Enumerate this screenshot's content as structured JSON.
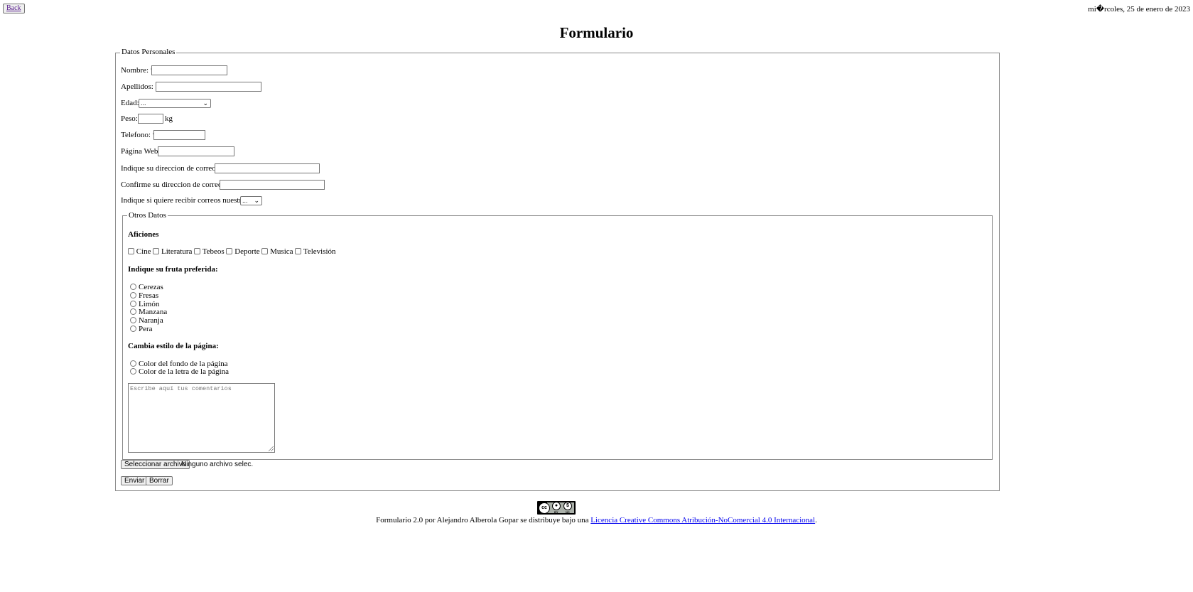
{
  "nav": {
    "back_label": "Back"
  },
  "date_text": "mi�rcoles, 25 de enero de 2023",
  "page_title": "Formulario",
  "personal": {
    "legend": "Datos Personales",
    "nombre_label": "Nombre: *",
    "apellidos_label": "Apellidos: *",
    "edad_label": "Edad:",
    "edad_value": "...",
    "peso_label": "Peso:",
    "peso_unit": "kg",
    "telefono_label": "Telefono: *",
    "web_label": "Página Web:",
    "email_label": "Indique su direccion de correo: *",
    "email_confirm_label": "Confirme su direccion de correo: *",
    "newsletter_label": "Indique si quiere recibir correos nuestros:",
    "newsletter_value": "..."
  },
  "other": {
    "legend": "Otros Datos",
    "hobbies_heading": "Aficiones",
    "hobbies": [
      "Cine",
      "Literatura",
      "Tebeos",
      "Deporte",
      "Musica",
      "Televisión"
    ],
    "fruit_heading": "Indique su fruta preferida:",
    "fruits": [
      "Cerezas",
      "Fresas",
      "Limón",
      "Manzana",
      "Naranja",
      "Pera"
    ],
    "style_heading": "Cambia estilo de la página:",
    "style_options": [
      "Color del fondo de la página",
      "Color de la letra de la página"
    ],
    "comments_placeholder": "Escribe aquí tus comentarios"
  },
  "file": {
    "button_label": "Seleccionar archivo",
    "status": "Ninguno archivo selec."
  },
  "actions": {
    "submit_label": "Enviar",
    "reset_label": "Borrar"
  },
  "license": {
    "badge": {
      "cc": "cc",
      "by": "BY",
      "nc": "NC"
    },
    "text": "Formulario 2.0 por Alejandro Alberola Gopar se distribuye bajo una",
    "link_text": "Licencia Creative Commons Atribución-NoComercial 4.0 Internacional",
    "suffix": "."
  }
}
